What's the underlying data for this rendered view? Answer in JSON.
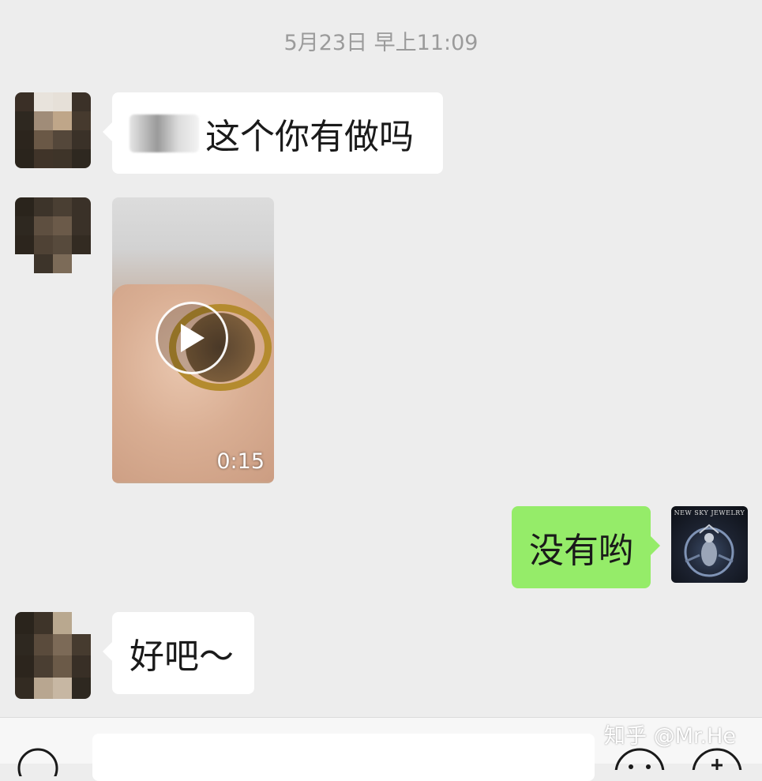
{
  "chat": {
    "timestamp": "5月23日 早上11:09",
    "messages": [
      {
        "side": "left",
        "type": "text",
        "text": "这个你有做吗"
      },
      {
        "side": "left",
        "type": "video",
        "duration": "0:15"
      },
      {
        "side": "right",
        "type": "text",
        "text": "没有哟"
      },
      {
        "side": "left",
        "type": "text",
        "text": "好吧～"
      }
    ]
  },
  "self_avatar": {
    "brand_text": "NEW SKY JEWELRY"
  },
  "watermark": "知乎 @Mr.He",
  "colors": {
    "background": "#ededed",
    "incoming_bubble": "#ffffff",
    "outgoing_bubble": "#95ec69",
    "timestamp": "#9b9b9b"
  },
  "icons": {
    "play": "play-icon",
    "voice": "voice-icon",
    "emoji": "emoji-icon",
    "plus": "plus-icon"
  }
}
